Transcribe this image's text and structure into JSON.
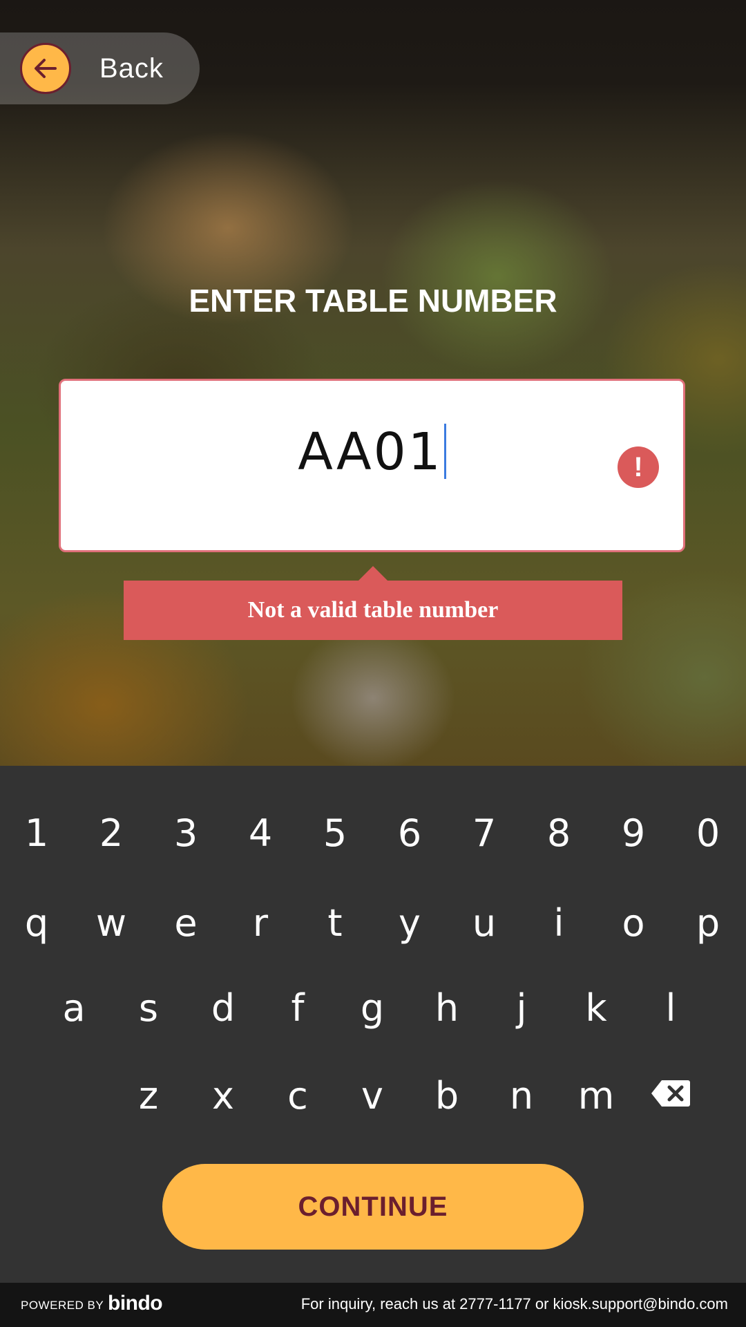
{
  "header": {
    "back_label": "Back"
  },
  "form": {
    "title": "ENTER TABLE NUMBER",
    "input_value": "AA01",
    "error_icon": "exclamation-icon",
    "error_message": "Not a valid table number"
  },
  "keyboard": {
    "rows": [
      [
        "1",
        "2",
        "3",
        "4",
        "5",
        "6",
        "7",
        "8",
        "9",
        "0"
      ],
      [
        "q",
        "w",
        "e",
        "r",
        "t",
        "y",
        "u",
        "i",
        "o",
        "p"
      ],
      [
        "a",
        "s",
        "d",
        "f",
        "g",
        "h",
        "j",
        "k",
        "l"
      ],
      [
        "z",
        "x",
        "c",
        "v",
        "b",
        "n",
        "m"
      ]
    ],
    "backspace_icon": "backspace-icon"
  },
  "actions": {
    "continue_label": "CONTINUE"
  },
  "footer": {
    "powered_by": "POWERED BY",
    "brand": "bindo",
    "inquiry": "For inquiry, reach us at 2777-1177 or  kiosk.support@bindo.com"
  },
  "colors": {
    "accent": "#FFB848",
    "accent_text": "#6B1F2E",
    "error": "#DA5A5A",
    "keyboard_bg": "#333333",
    "footer_bg": "#141414"
  }
}
